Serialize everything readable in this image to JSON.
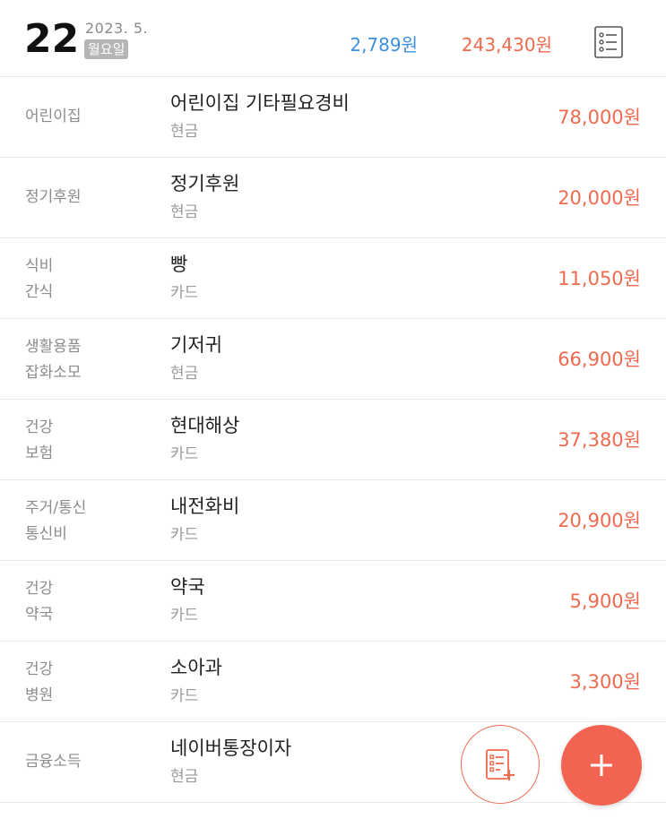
{
  "header": {
    "day": "22",
    "year_month": "2023. 5.",
    "weekday": "월요일",
    "income_total": "2,789원",
    "expense_total": "243,430원",
    "list_icon": "list-icon"
  },
  "colors": {
    "income": "#3d8fe0",
    "expense": "#f06a4f",
    "fab": "#f26451"
  },
  "transactions": [
    {
      "cat1": "어린이집",
      "cat2": "",
      "desc": "어린이집 기타필요경비",
      "pay": "현금",
      "amount": "78,000원"
    },
    {
      "cat1": "정기후원",
      "cat2": "",
      "desc": "정기후원",
      "pay": "현금",
      "amount": "20,000원"
    },
    {
      "cat1": "식비",
      "cat2": "간식",
      "desc": "빵",
      "pay": "카드",
      "amount": "11,050원"
    },
    {
      "cat1": "생활용품",
      "cat2": "잡화소모",
      "desc": "기저귀",
      "pay": "현금",
      "amount": "66,900원"
    },
    {
      "cat1": "건강",
      "cat2": "보험",
      "desc": "현대해상",
      "pay": "카드",
      "amount": "37,380원"
    },
    {
      "cat1": "주거/통신",
      "cat2": "통신비",
      "desc": "내전화비",
      "pay": "카드",
      "amount": "20,900원"
    },
    {
      "cat1": "건강",
      "cat2": "약국",
      "desc": "약국",
      "pay": "카드",
      "amount": "5,900원"
    },
    {
      "cat1": "건강",
      "cat2": "병원",
      "desc": "소아과",
      "pay": "카드",
      "amount": "3,300원"
    },
    {
      "cat1": "금융소득",
      "cat2": "",
      "desc": "네이버통장이자",
      "pay": "현금",
      "amount": ""
    }
  ],
  "fab": {
    "memo_icon": "memo-add-icon",
    "add_icon": "plus-icon"
  }
}
